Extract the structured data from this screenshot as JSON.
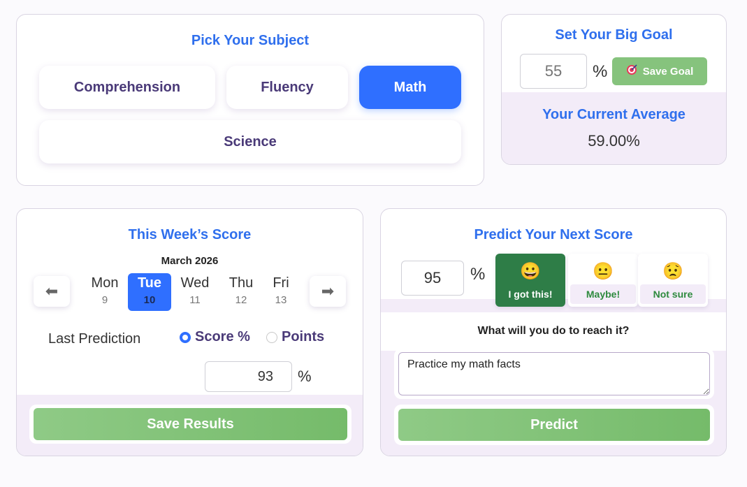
{
  "subject": {
    "title": "Pick Your Subject",
    "options": [
      "Comprehension",
      "Fluency",
      "Math",
      "Science"
    ],
    "selected": "Math"
  },
  "goal": {
    "title": "Set Your Big Goal",
    "value": "55",
    "unit": "%",
    "save_label": "Save Goal",
    "save_icon": "target-icon",
    "average_title": "Your Current Average",
    "average_value": "59.00%"
  },
  "week": {
    "title": "This Week’s Score",
    "month": "March 2026",
    "prev_arrow": "⬅",
    "next_arrow": "➡",
    "days": [
      {
        "name": "Mon",
        "num": "9"
      },
      {
        "name": "Tue",
        "num": "10"
      },
      {
        "name": "Wed",
        "num": "11"
      },
      {
        "name": "Thu",
        "num": "12"
      },
      {
        "name": "Fri",
        "num": "13"
      }
    ],
    "selected_day": "Tue",
    "last_prediction_label": "Last Prediction",
    "mode_options": [
      "Score %",
      "Points"
    ],
    "selected_mode": "Score %",
    "value": "93",
    "unit": "%",
    "save_label": "Save Results"
  },
  "predict": {
    "title": "Predict Your Next Score",
    "value": "95",
    "unit": "%",
    "confidence": [
      {
        "emoji": "😀",
        "label": "I got this!"
      },
      {
        "emoji": "😐",
        "label": "Maybe!"
      },
      {
        "emoji": "😟",
        "label": "Not sure"
      }
    ],
    "selected_confidence": "I got this!",
    "plan_question": "What will you do to reach it?",
    "plan_text": "Practice my math facts",
    "predict_label": "Predict"
  },
  "colors": {
    "accent_blue": "#2f6fff",
    "title_blue": "#2f6fed",
    "green": "#75bb6a",
    "dark_green": "#2e7d47",
    "lavender": "#f3ecf8"
  }
}
